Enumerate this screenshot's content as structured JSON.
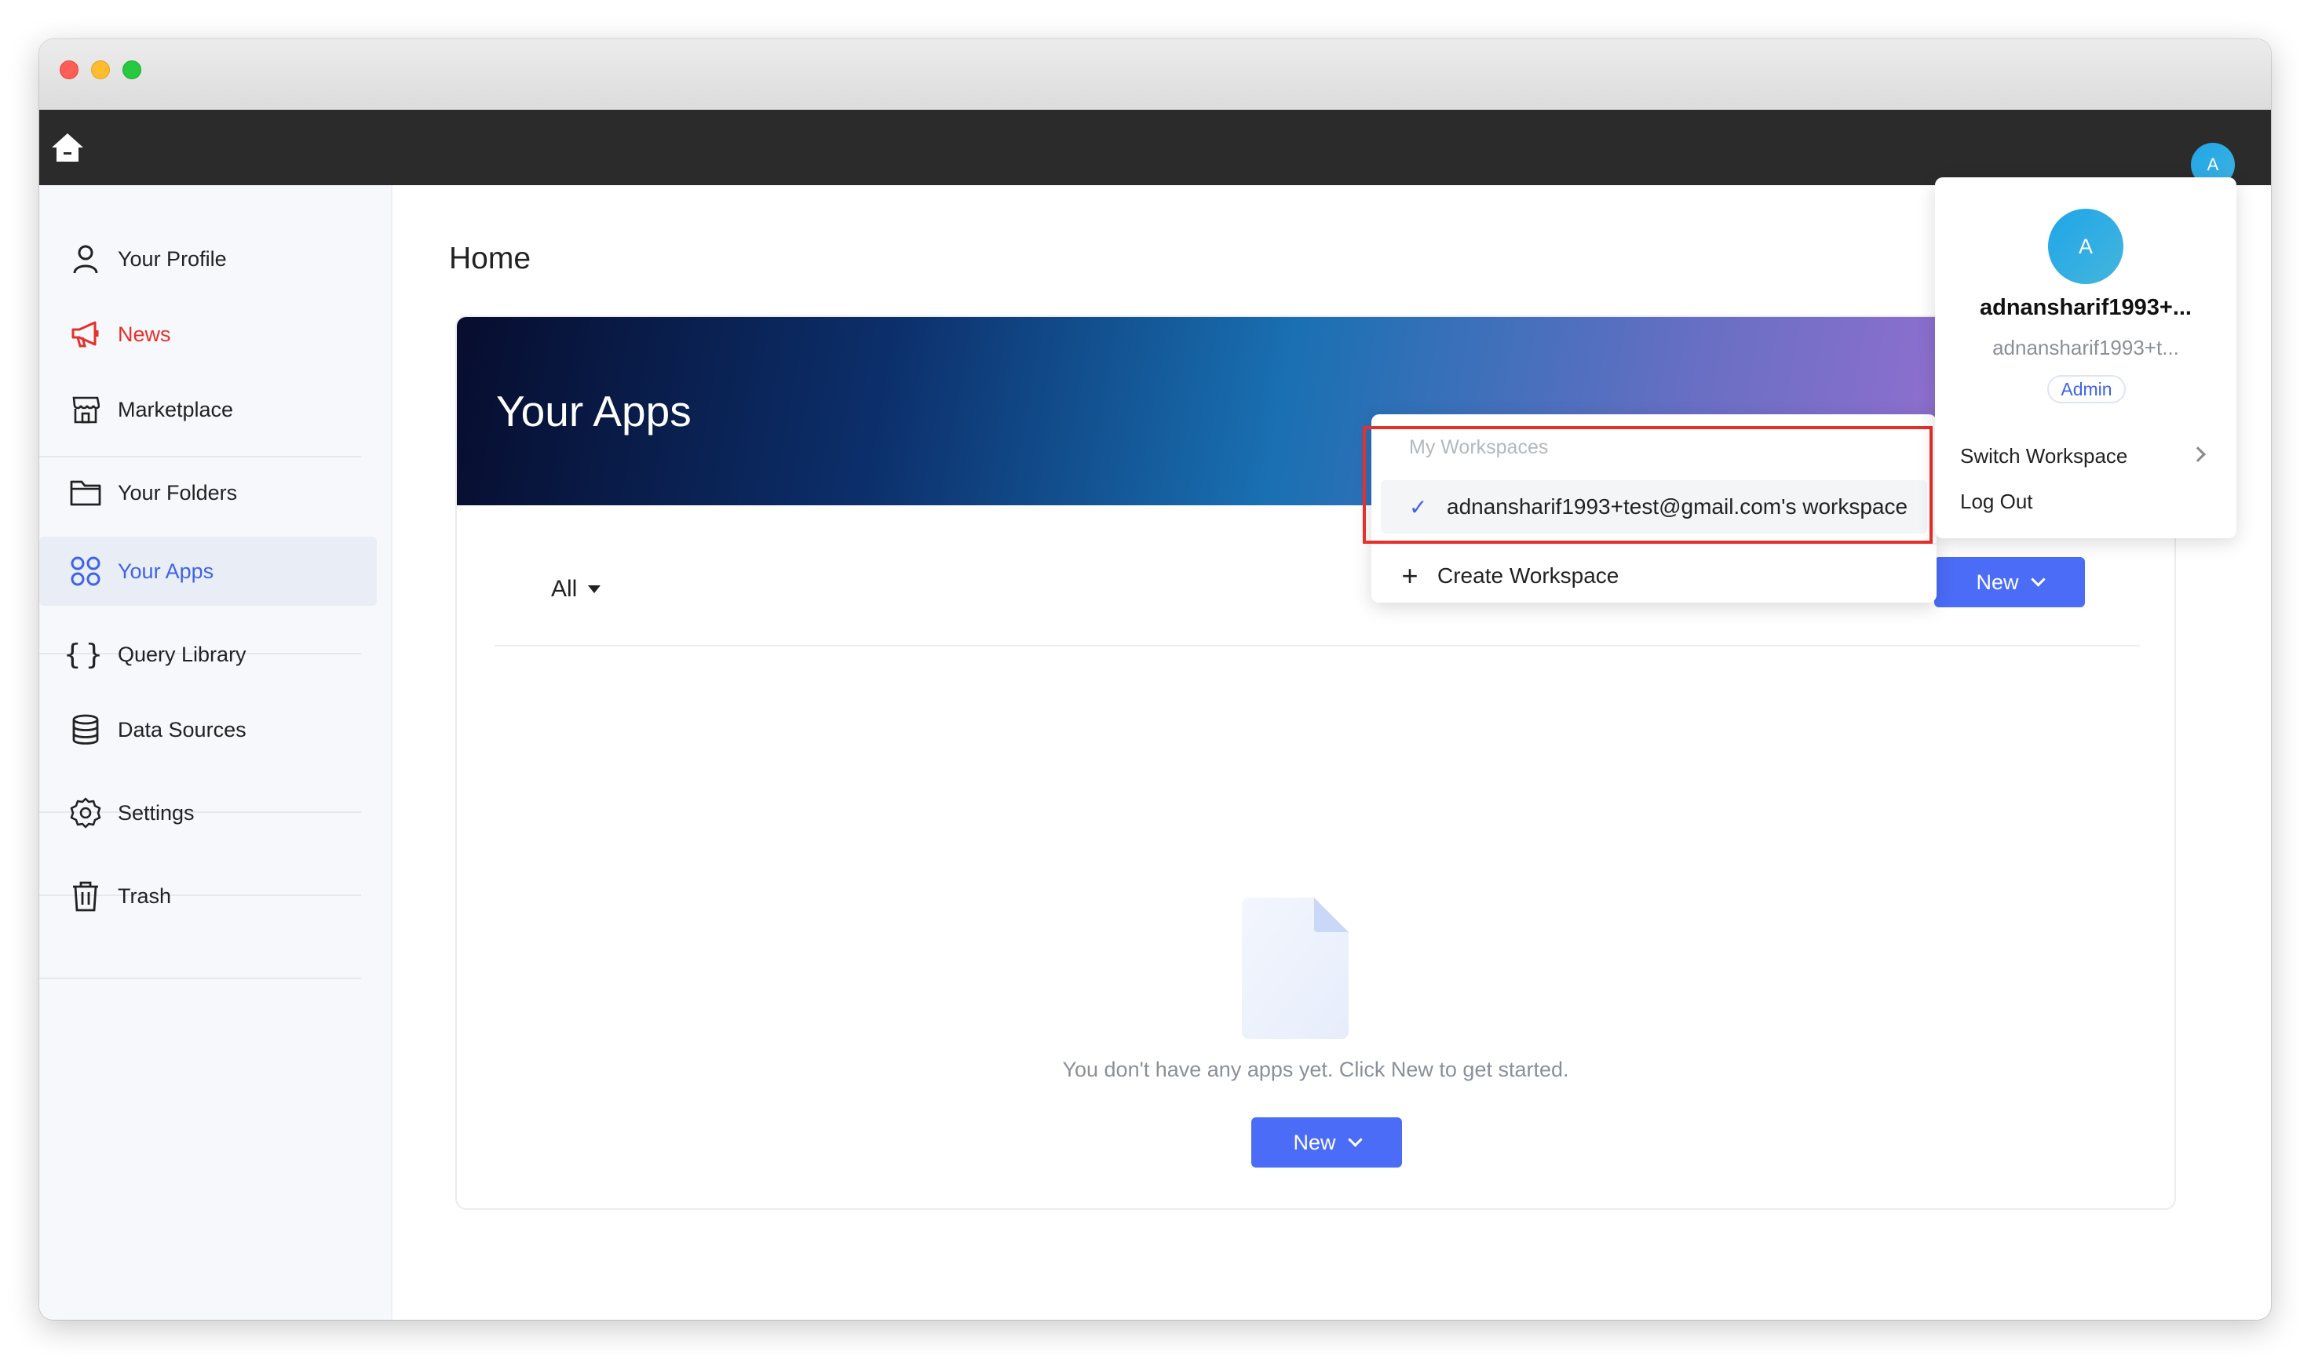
{
  "header": {
    "avatar_initial": "A"
  },
  "sidebar": {
    "items": [
      {
        "label": "Your Profile"
      },
      {
        "label": "News"
      },
      {
        "label": "Marketplace"
      },
      {
        "label": "Your Folders"
      },
      {
        "label": "Your Apps"
      },
      {
        "label": "Query Library"
      },
      {
        "label": "Data Sources"
      },
      {
        "label": "Settings"
      },
      {
        "label": "Trash"
      }
    ]
  },
  "main": {
    "page_title": "Home",
    "banner_title": "Your Apps",
    "filter_label": "All",
    "new_button_label": "New",
    "empty_message": "You don't have any apps yet. Click New to get started.",
    "empty_new_button_label": "New"
  },
  "workspace_dropdown": {
    "header": "My Workspaces",
    "selected_workspace": "adnansharif1993+test@gmail.com's workspace",
    "create_label": "Create Workspace"
  },
  "profile_panel": {
    "avatar_initial": "A",
    "name": "adnansharif1993+...",
    "email": "adnansharif1993+t...",
    "role": "Admin",
    "switch_workspace_label": "Switch Workspace",
    "logout_label": "Log Out"
  },
  "colors": {
    "accent": "#4a6cf7",
    "news_red": "#e5302b",
    "highlight_red": "#e5302b",
    "topbar": "#2b2b2b"
  }
}
